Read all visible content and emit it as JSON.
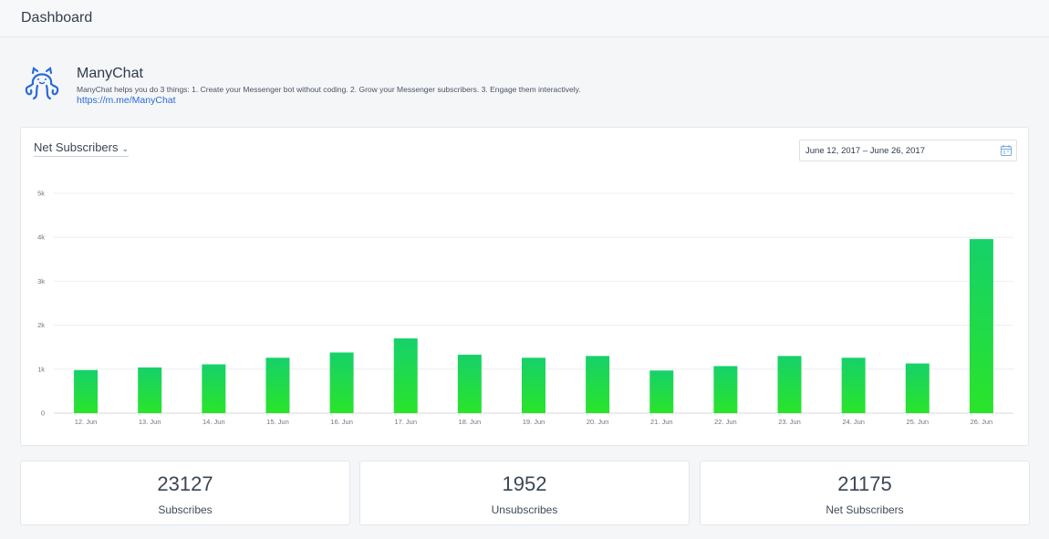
{
  "header": {
    "title": "Dashboard"
  },
  "bot": {
    "name": "ManyChat",
    "description": "ManyChat helps you do 3 things: 1. Create your Messenger bot without coding. 2. Grow your Messenger subscribers. 3. Engage them interactively.",
    "link": "https://m.me/ManyChat",
    "logo_icon": "octopus-logo-icon",
    "logo_color": "#2a6bd8"
  },
  "chart_panel": {
    "metric_label": "Net Subscribers",
    "metric_icon": "chevron-down-icon",
    "date_range": "June 12, 2017 – June 26, 2017",
    "date_icon": "calendar-icon"
  },
  "chart_data": {
    "type": "bar",
    "categories": [
      "12. Jun",
      "13. Jun",
      "14. Jun",
      "15. Jun",
      "16. Jun",
      "17. Jun",
      "18. Jun",
      "19. Jun",
      "20. Jun",
      "21. Jun",
      "22. Jun",
      "23. Jun",
      "24. Jun",
      "25. Jun",
      "26. Jun"
    ],
    "values": [
      980,
      1040,
      1110,
      1260,
      1380,
      1700,
      1330,
      1260,
      1300,
      970,
      1070,
      1300,
      1260,
      1130,
      3960
    ],
    "ylim": [
      0,
      5000
    ],
    "yticks": [
      "0",
      "1k",
      "2k",
      "3k",
      "4k",
      "5k"
    ],
    "ytick_values": [
      0,
      1000,
      2000,
      3000,
      4000,
      5000
    ],
    "grid": true,
    "bar_color_top": "#16d16a",
    "bar_color_bottom": "#2ae42a",
    "title": "",
    "xlabel": "",
    "ylabel": ""
  },
  "stats": [
    {
      "value": "23127",
      "label": "Subscribes"
    },
    {
      "value": "1952",
      "label": "Unsubscribes"
    },
    {
      "value": "21175",
      "label": "Net Subscribers"
    }
  ]
}
